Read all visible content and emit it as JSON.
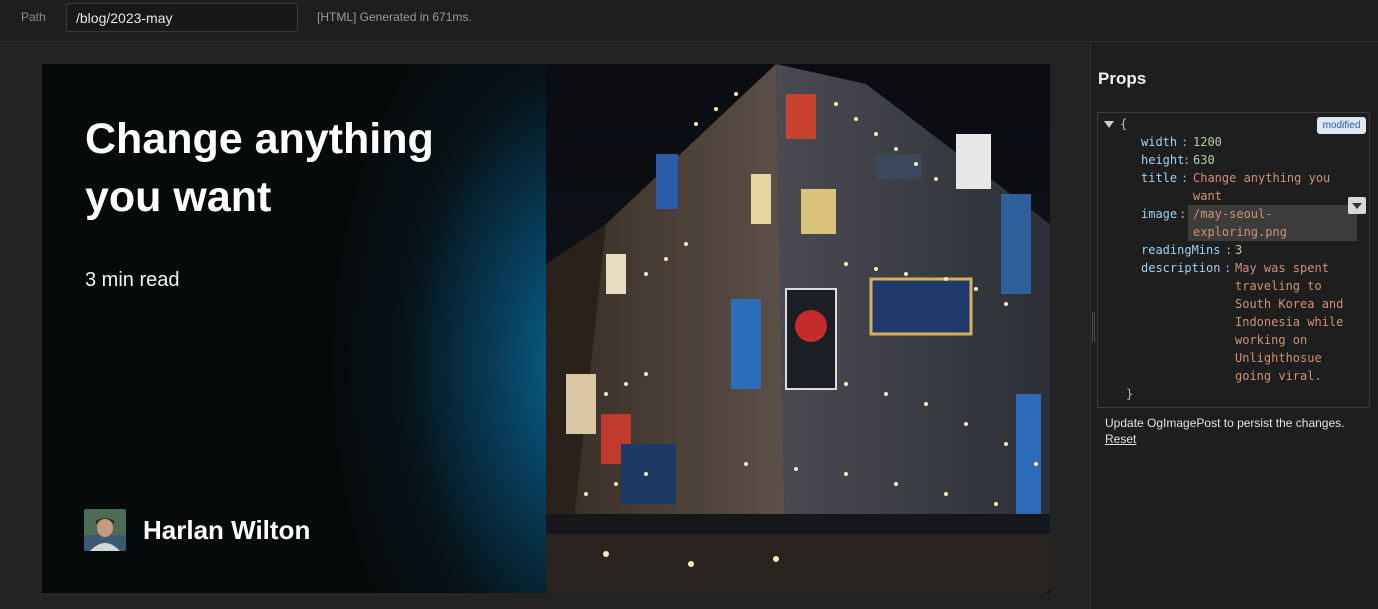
{
  "topbar": {
    "path_label": "Path",
    "path_value": "/blog/2023-may",
    "status": "[HTML] Generated in 671ms."
  },
  "og": {
    "title": "Change anything you want",
    "reading": "3 min read",
    "author": "Harlan Wilton"
  },
  "props": {
    "heading": "Props",
    "badge": "modified",
    "open_brace": "{",
    "close_brace": "}",
    "width_key": "width",
    "width_val": "1200",
    "height_key": "height",
    "height_val": "630",
    "title_key": "title",
    "title_val": "Change anything you want",
    "image_key": "image",
    "image_val": "/may-seoul-exploring.png",
    "reading_key": "readingMins",
    "reading_val": "3",
    "desc_key": "description",
    "desc_val": "May was spent traveling to South Korea and Indonesia while working on Unlighthosue going viral."
  },
  "footer": {
    "hint": "Update OgImagePost to persist the changes.",
    "reset": "Reset"
  }
}
